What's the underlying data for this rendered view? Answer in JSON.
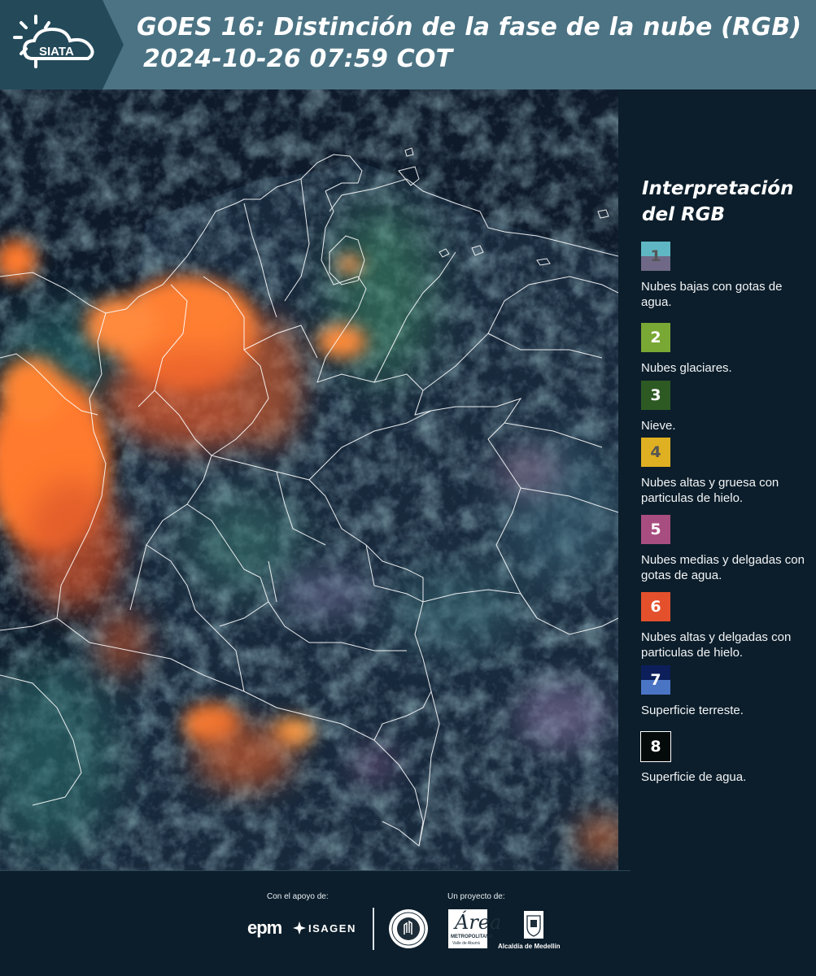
{
  "header": {
    "logo_text": "SIATA",
    "title_line1": "GOES 16: Distinción de la fase de la nube (RGB)",
    "title_line2": "2024-10-26 07:59 COT"
  },
  "colors": {
    "header_bg": "#4b7384",
    "logo_bg": "#244a5a",
    "panel_bg": "#0c1e2b",
    "map_water": "#0e1a2a",
    "cloud_orange": "#ff7a2e",
    "border_lines": "#ffffff"
  },
  "legend": {
    "title": "Interpretación del RGB",
    "items": [
      {
        "number": "1",
        "label": "Nubes bajas con gotas de agua.",
        "color_top": "#5fb7c4",
        "color_bottom": "#6f6987",
        "number_color": "#555555"
      },
      {
        "number": "2",
        "label": "Nubes glaciares.",
        "color_top": "#7aa834",
        "color_bottom": "#7aa834",
        "number_color": "#ffffff"
      },
      {
        "number": "3",
        "label": "Nieve.",
        "color_top": "#2d5a23",
        "color_bottom": "#2d5a23",
        "number_color": "#ffffff"
      },
      {
        "number": "4",
        "label": "Nubes altas y gruesa con particulas de hielo.",
        "color_top": "#dfb021",
        "color_bottom": "#dfb021",
        "number_color": "#555555"
      },
      {
        "number": "5",
        "label": "Nubes medias y delgadas con gotas de agua.",
        "color_top": "#a84d80",
        "color_bottom": "#a84d80",
        "number_color": "#ffffff"
      },
      {
        "number": "6",
        "label": "Nubes altas y delgadas con particulas de hielo.",
        "color_top": "#e4502c",
        "color_bottom": "#e4502c",
        "number_color": "#ffffff"
      },
      {
        "number": "7",
        "label": "Superficie terreste.",
        "color_top": "#0c1f5a",
        "color_bottom": "#4a74c4",
        "number_color": "#ffffff"
      },
      {
        "number": "8",
        "label": "Superficie de agua.",
        "color_top": "#050b0b",
        "color_bottom": "#050b0b",
        "number_color": "#ffffff"
      }
    ]
  },
  "footer": {
    "support_label": "Con el apoyo de:",
    "project_label": "Un proyecto de:",
    "epm_text": "epm",
    "isagen_text": "ISAGEN",
    "amva_letter": "Área",
    "amva_line1": "METROPOLITANA",
    "amva_line2": "Valle de Aburrá",
    "alcaldia_text": "Alcaldía de Medellín"
  }
}
